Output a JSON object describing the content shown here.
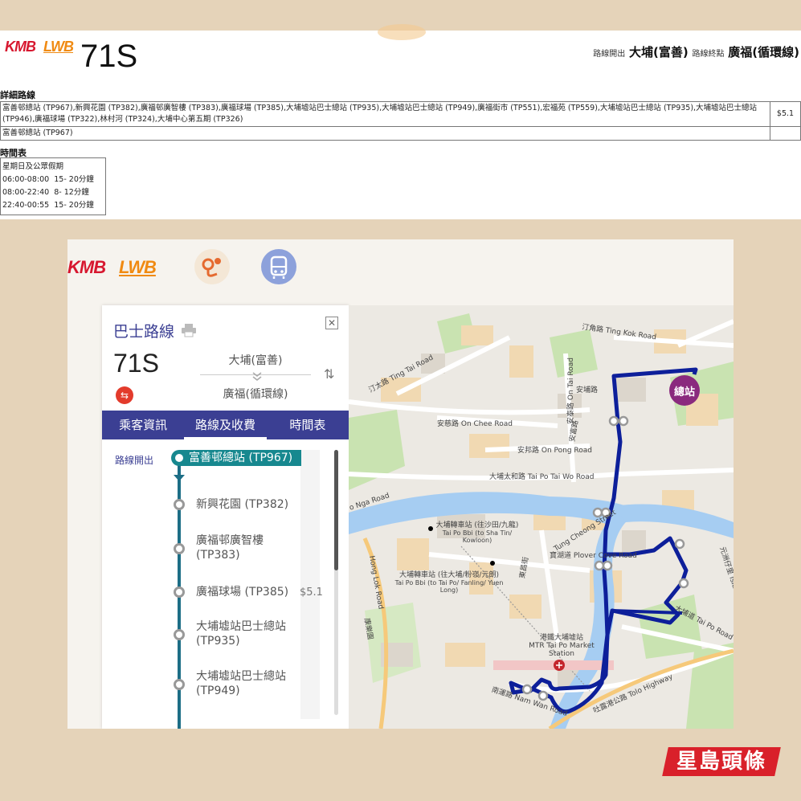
{
  "top": {
    "logo_kmb": "KMB",
    "logo_lwb": "LWB",
    "route_number": "71S",
    "origin_label": "路線開出",
    "origin": "大埔(富善)",
    "dest_label": "路線終點",
    "dest": "廣福(循環線)",
    "detail_title": "詳細路線",
    "route_text": "富善邨總站 (TP967),新興花園 (TP382),廣福邨廣智樓 (TP383),廣福球場 (TP385),大埔墟站巴士總站 (TP935),大埔墟站巴士總站 (TP949),廣福街市 (TP551),宏福苑 (TP559),大埔墟站巴士總站 (TP935),大埔墟站巴士總站 (TP946),廣福球場 (TP322),林村河 (TP324),大埔中心第五期 (TP326)",
    "fare": "$5.1",
    "return_text": "富善邨總站 (TP967)",
    "timetable_title": "時間表",
    "timetable_header": "星期日及公眾假期",
    "timetable_rows": [
      {
        "time": "06:00-08:00",
        "freq": "15- 20分鐘"
      },
      {
        "time": "08:00-22:40",
        "freq": "8- 12分鐘"
      },
      {
        "time": "22:40-00:55",
        "freq": "15- 20分鐘"
      }
    ]
  },
  "app": {
    "logo_kmb": "KMB",
    "logo_lwb": "LWB",
    "panel_title": "巴士路線",
    "route_number": "71S",
    "from": "大埔(富善)",
    "to": "廣福(循環線)",
    "tabs": [
      "乘客資訊",
      "路線及收費",
      "時間表"
    ],
    "start_label": "路線開出",
    "first_stop": "富善邨總站 (TP967)",
    "stops": [
      {
        "name": "新興花園 (TP382)",
        "fare": ""
      },
      {
        "name": "廣福邨廣智樓 (TP383)",
        "fare": ""
      },
      {
        "name": "廣福球場 (TP385)",
        "fare": "$5.1"
      },
      {
        "name": "大埔墟站巴士總站 (TP935)",
        "fare": ""
      },
      {
        "name": "大埔墟站巴士總站 (TP949)",
        "fare": ""
      }
    ]
  },
  "map": {
    "terminus": "總站",
    "labels": {
      "ting_kok": "汀角路 Ting Kok Road",
      "ting_tai": "汀太路 Ting Tai Road",
      "on_chee": "安慈路 On Chee Road",
      "on_pong": "安邦路 On Pong Road",
      "on_tai": "安泰路 On Tai Road",
      "on_po": "安埔路",
      "on_fu": "安富路",
      "tai_po_tai_wo": "大埔太和路 Tai Po Tai Wo Road",
      "nga_road": "o Nga Road",
      "bbi_shatin": "大埔轉車站 (往沙田/九龍)",
      "bbi_shatin_en": "Tai Po Bbi (to Sha Tin/ Kowloon)",
      "bbi_fanling": "大埔轉車站 (往大埔/粉嶺/元朗)",
      "bbi_fanling_en": "Tai Po Bbi (to Tai Po/ Fanling/ Yuen Long)",
      "tung_cheong": "Tung Cheong Street",
      "plover_cove": "寶湖道 Plover Cove Road",
      "island_house": "元洲仔里 Island House",
      "tai_po_road": "大埔道 Tai Po Road",
      "tung_cheong_cn": "東昌街",
      "hong_lok": "Hong Lok Road",
      "hong_lok_cn": "康樂園",
      "mtr_cn": "港鐵大埔墟站",
      "mtr_en": "MTR Tai Po Market Station",
      "nam_wan": "南運路 Nam Wan Road",
      "tolo": "吐露港公路 Tolo Highway"
    }
  },
  "brand": "星島頭條",
  "colors": {
    "accent": "#3b3f93",
    "route_line": "#0d1f9a",
    "terminus": "#8a2a7e",
    "brand": "#d9202a"
  }
}
